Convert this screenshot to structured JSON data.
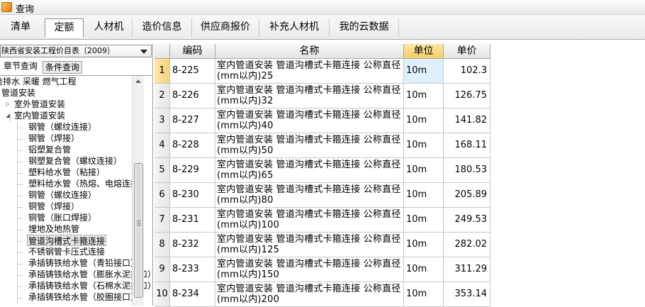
{
  "window": {
    "title": "查询",
    "icon": "app-query-icon"
  },
  "tabs": [
    {
      "label": "清单"
    },
    {
      "label": "定额"
    },
    {
      "label": "人材机"
    },
    {
      "label": "造价信息"
    },
    {
      "label": "供应商报价"
    },
    {
      "label": "补充人材机"
    },
    {
      "label": "我的云数据"
    }
  ],
  "left": {
    "catalog": "陕西省安装工程价目表（2009）",
    "subtabs": [
      "章节查询",
      "条件查询"
    ],
    "tree": [
      "给排水 采暖 燃气工程",
      "管道安装",
      "室外管道安装",
      "室内管道安装",
      "钢管（螺纹连接）",
      "钢管（焊接）",
      "铝塑复合管",
      "钢塑复合管（螺纹连接）",
      "塑料给水管（粘接）",
      "塑料给水管（热熔、电熔连接）",
      "铜管（螺纹连接）",
      "铜管（焊接）",
      "铜管（胀口焊接）",
      "埋地及地热管",
      "管道沟槽式卡箍连接",
      "不锈钢管卡压式连接",
      "承插铸铁给水管（青铅接口）",
      "承插铸铁给水管（膨胀水泥接口）",
      "承插铸铁给水管（石棉水泥接口）",
      "承插铸铁给水管（胶圈接口）"
    ]
  },
  "grid": {
    "columns": [
      "编码",
      "名称",
      "单位",
      "单价"
    ],
    "rows": [
      {
        "no": "1",
        "code": "8-225",
        "name": "室内管道安装 管道沟槽式卡箍连接 公称直径(mm以内)25",
        "unit": "10m",
        "price": "102.3"
      },
      {
        "no": "2",
        "code": "8-226",
        "name": "室内管道安装 管道沟槽式卡箍连接 公称直径(mm以内)32",
        "unit": "10m",
        "price": "126.75"
      },
      {
        "no": "3",
        "code": "8-227",
        "name": "室内管道安装 管道沟槽式卡箍连接 公称直径(mm以内)40",
        "unit": "10m",
        "price": "141.82"
      },
      {
        "no": "4",
        "code": "8-228",
        "name": "室内管道安装 管道沟槽式卡箍连接 公称直径(mm以内)50",
        "unit": "10m",
        "price": "168.11"
      },
      {
        "no": "5",
        "code": "8-229",
        "name": "室内管道安装 管道沟槽式卡箍连接 公称直径(mm以内)65",
        "unit": "10m",
        "price": "180.53"
      },
      {
        "no": "6",
        "code": "8-230",
        "name": "室内管道安装 管道沟槽式卡箍连接 公称直径(mm以内)80",
        "unit": "10m",
        "price": "205.89"
      },
      {
        "no": "7",
        "code": "8-231",
        "name": "室内管道安装 管道沟槽式卡箍连接 公称直径(mm以内)100",
        "unit": "10m",
        "price": "249.53"
      },
      {
        "no": "8",
        "code": "8-232",
        "name": "室内管道安装 管道沟槽式卡箍连接 公称直径(mm以内)125",
        "unit": "10m",
        "price": "282.02"
      },
      {
        "no": "9",
        "code": "8-233",
        "name": "室内管道安装 管道沟槽式卡箍连接 公称直径(mm以内)150",
        "unit": "10m",
        "price": "311.29"
      },
      {
        "no": "10",
        "code": "8-234",
        "name": "室内管道安装 管道沟槽式卡箍连接 公称直径(mm以内)200",
        "unit": "10m",
        "price": "353.14"
      }
    ]
  },
  "colors": {
    "header_highlight": "#f4cf6a",
    "selected_cell": "#dff0fc"
  }
}
